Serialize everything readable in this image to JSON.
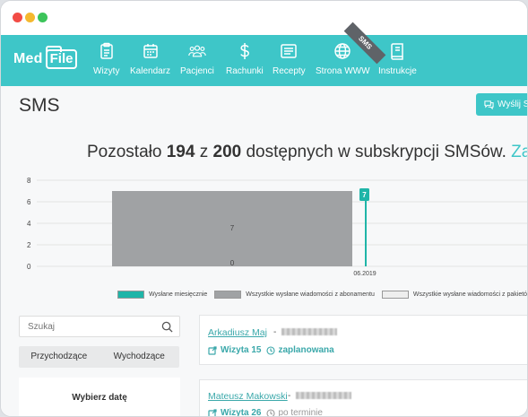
{
  "window": {
    "controls": [
      "close",
      "minimize",
      "maximize"
    ]
  },
  "nav": {
    "logo_med": "Med",
    "logo_file": "File",
    "items": [
      {
        "label": "Wizyty",
        "icon": "clipboard-icon"
      },
      {
        "label": "Kalendarz",
        "icon": "calendar-icon"
      },
      {
        "label": "Pacjenci",
        "icon": "users-icon"
      },
      {
        "label": "Rachunki",
        "icon": "dollar-icon"
      },
      {
        "label": "Recepty",
        "icon": "prescription-icon"
      },
      {
        "label": "Strona WWW",
        "icon": "globe-icon"
      },
      {
        "label": "Instrukcje",
        "icon": "book-icon"
      }
    ],
    "ribbon": "SMS",
    "accent": "#3ec6c8"
  },
  "page": {
    "title": "SMS",
    "send_button": "Wyślij S"
  },
  "quota": {
    "prefix": "Pozostało ",
    "remaining": "194",
    "middle": " z ",
    "total": "200",
    "suffix": " dostępnych w subskrypcji SMSów. ",
    "link": "Za"
  },
  "chart_data": {
    "type": "bar",
    "categories": [
      "",
      "06.2019"
    ],
    "yticks": [
      "0",
      "2",
      "4",
      "6",
      "8"
    ],
    "ylim": [
      0,
      8
    ],
    "series": [
      {
        "name": "Wysłane miesięcznie",
        "color": "#1fb5a8",
        "values": [
          0,
          7
        ],
        "labels": [
          "",
          "7"
        ]
      },
      {
        "name": "Wszystkie wysłane wiadomości z abonamentu",
        "color": "#a0a2a4",
        "values": [
          7,
          0
        ],
        "labels": [
          "7",
          ""
        ]
      },
      {
        "name": "Wszystkie wysłane wiadomości z pakietów",
        "color": "#eeeeee",
        "values": [
          0,
          0
        ],
        "labels": [
          "0",
          ""
        ]
      }
    ],
    "legend": [
      {
        "label": "Wysłane miesięcznie",
        "color": "#1fb5a8"
      },
      {
        "label": "Wszystkie wysłane wiadomości z abonamentu",
        "color": "#a0a2a4"
      },
      {
        "label": "Wszystkie wysłane wiadomości z pakietów",
        "color": "#eeeeee"
      },
      {
        "label": "",
        "color": "#1e7bc4"
      }
    ]
  },
  "sidebar": {
    "search_placeholder": "Szukaj",
    "tab_incoming": "Przychodzące",
    "tab_outgoing": "Wychodzące",
    "date_label": "Wybierz datę"
  },
  "messages": [
    {
      "name": "Arkadiusz Maj",
      "sep": " - ",
      "visit": "Wizyta 15",
      "status": "zaplanowana",
      "status_color": "#3aa8aa"
    },
    {
      "name": "Mateusz Makowski",
      "sep": " - ",
      "visit": "Wizyta 26",
      "status": "po terminie",
      "status_color": "#999999"
    }
  ]
}
